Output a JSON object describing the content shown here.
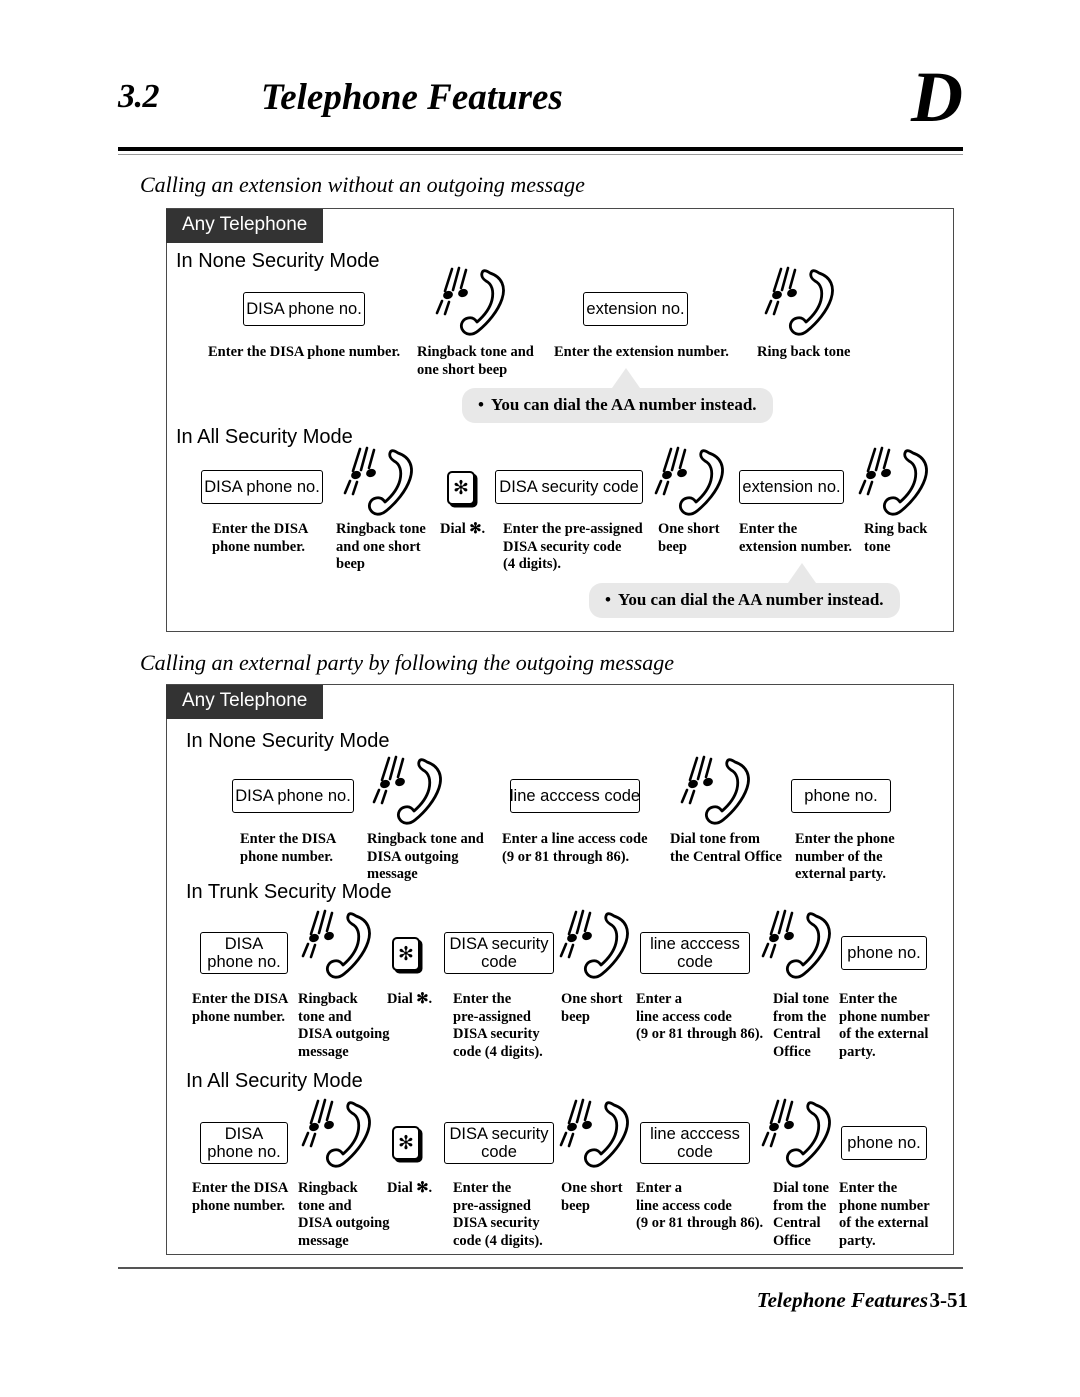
{
  "header": {
    "section_number": "3.2",
    "title": "Telephone Features",
    "corner_letter": "D"
  },
  "footer": {
    "title": "Telephone Features",
    "page": "3-51"
  },
  "sections": [
    {
      "heading": "Calling an extension without an outgoing message",
      "tab": "Any Telephone",
      "modes": [
        {
          "title": "In None Security Mode",
          "steps": [
            {
              "kind": "box",
              "label": "DISA phone no.",
              "caption": "Enter the DISA phone number."
            },
            {
              "kind": "handset",
              "caption": "Ringback tone and\none short beep"
            },
            {
              "kind": "box",
              "label": "extension no.",
              "caption": "Enter the extension number."
            },
            {
              "kind": "handset",
              "caption": "Ring back tone"
            }
          ],
          "callout": "You can dial the AA number instead."
        },
        {
          "title": "In All Security Mode",
          "steps": [
            {
              "kind": "box",
              "label": "DISA phone no.",
              "caption": "Enter the DISA\nphone number."
            },
            {
              "kind": "handset",
              "caption": "Ringback tone\nand one short\nbeep"
            },
            {
              "kind": "star",
              "label": "✻",
              "caption": "Dial ✻."
            },
            {
              "kind": "box",
              "label": "DISA security code",
              "caption": "Enter the pre-assigned\nDISA security code\n(4 digits)."
            },
            {
              "kind": "handset",
              "caption": "One short\nbeep"
            },
            {
              "kind": "box",
              "label": "extension no.",
              "caption": "Enter the\nextension number."
            },
            {
              "kind": "handset",
              "caption": "Ring back\ntone"
            }
          ],
          "callout": "You can dial the AA number instead."
        }
      ]
    },
    {
      "heading": "Calling an external party by following the outgoing message",
      "tab": "Any Telephone",
      "modes": [
        {
          "title": "In None Security Mode",
          "steps": [
            {
              "kind": "box",
              "label": "DISA phone no.",
              "caption": "Enter the DISA\nphone number."
            },
            {
              "kind": "handset",
              "caption": "Ringback tone and\nDISA outgoing\nmessage"
            },
            {
              "kind": "box",
              "label": "line acccess code",
              "caption": "Enter a line access code\n(9 or 81 through 86)."
            },
            {
              "kind": "handset",
              "caption": "Dial tone from\nthe Central Office"
            },
            {
              "kind": "box",
              "label": "phone no.",
              "caption": "Enter the phone\nnumber of the\nexternal party."
            }
          ],
          "callout": null
        },
        {
          "title": "In Trunk Security Mode",
          "steps": [
            {
              "kind": "box",
              "label": "DISA\nphone no.",
              "caption": "Enter the DISA\nphone number."
            },
            {
              "kind": "handset",
              "caption": "Ringback\ntone and\nDISA outgoing\nmessage"
            },
            {
              "kind": "star",
              "label": "✻",
              "caption": "Dial ✻."
            },
            {
              "kind": "box",
              "label": "DISA security\ncode",
              "caption": "Enter the\npre-assigned\nDISA security\ncode (4 digits)."
            },
            {
              "kind": "handset",
              "caption": "One short\nbeep"
            },
            {
              "kind": "box",
              "label": "line acccess\ncode",
              "caption": "Enter a\nline access code\n(9 or 81 through 86)."
            },
            {
              "kind": "handset",
              "caption": "Dial tone\nfrom the\nCentral\nOffice"
            },
            {
              "kind": "box",
              "label": "phone no.",
              "caption": "Enter the\nphone number\nof the external\nparty."
            }
          ],
          "callout": null
        },
        {
          "title": "In All Security Mode",
          "steps": [
            {
              "kind": "box",
              "label": "DISA\nphone no.",
              "caption": "Enter the DISA\nphone number."
            },
            {
              "kind": "handset",
              "caption": "Ringback\ntone and\nDISA outgoing\nmessage"
            },
            {
              "kind": "star",
              "label": "✻",
              "caption": "Dial ✻."
            },
            {
              "kind": "box",
              "label": "DISA security\ncode",
              "caption": "Enter the\npre-assigned\nDISA security\ncode (4 digits)."
            },
            {
              "kind": "handset",
              "caption": "One short\nbeep"
            },
            {
              "kind": "box",
              "label": "line acccess\ncode",
              "caption": "Enter a\nline access code\n(9 or 81 through 86)."
            },
            {
              "kind": "handset",
              "caption": "Dial tone\nfrom the\nCentral\nOffice"
            },
            {
              "kind": "box",
              "label": "phone no.",
              "caption": "Enter the\nphone number\nof the external\nparty."
            }
          ],
          "callout": null
        }
      ]
    }
  ],
  "colors": {
    "tab_bg": "#333333",
    "callout_bg": "#e8e8e8",
    "rule": "#000000"
  }
}
